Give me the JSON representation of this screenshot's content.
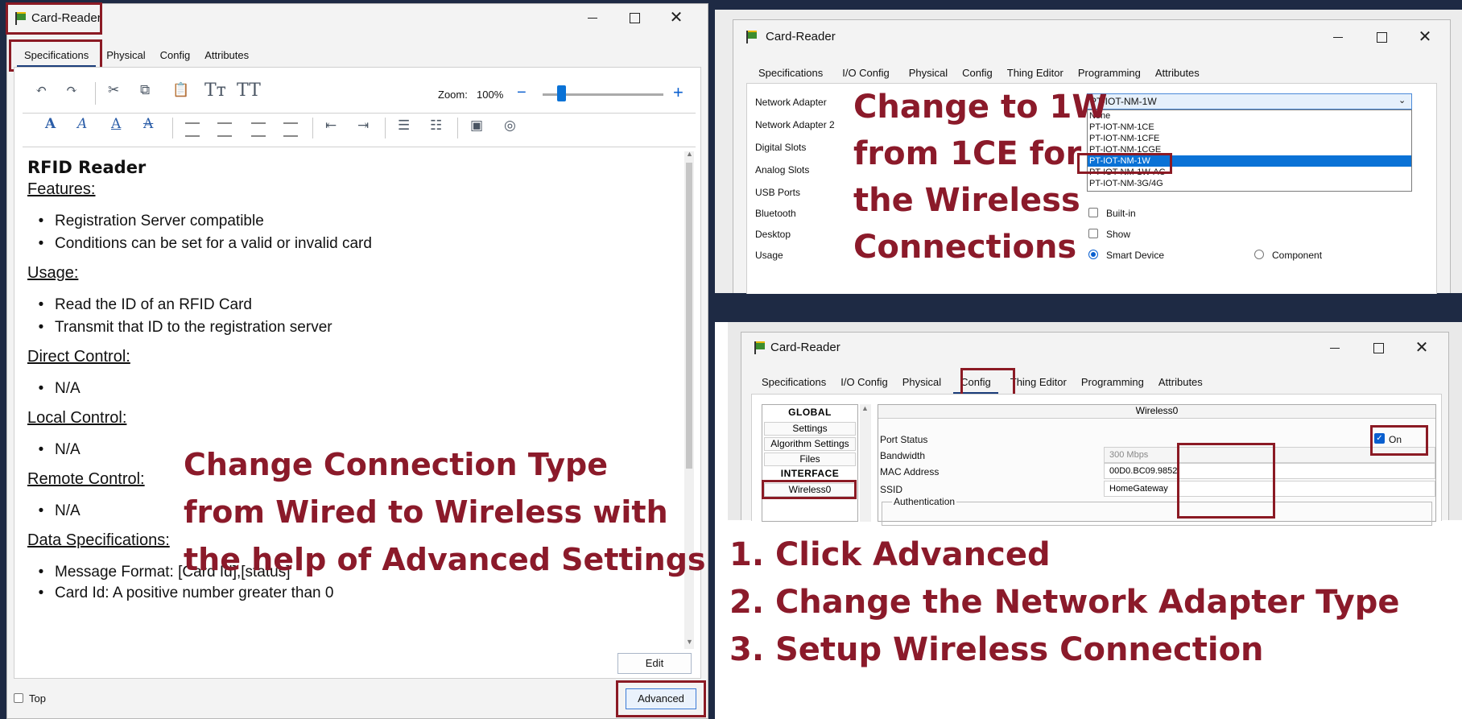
{
  "window_left": {
    "title": "Card-Reader",
    "tabs": [
      "Specifications",
      "Physical",
      "Config",
      "Attributes"
    ],
    "active_tab": "Specifications",
    "zoom_label": "Zoom:",
    "zoom_value": "100%",
    "zoom_minus": "−",
    "zoom_plus": "+",
    "zoom_slider_fraction": 0.17,
    "toolbar_icons": [
      "undo-icon",
      "redo-icon",
      "cut-icon",
      "copy-icon",
      "paste-icon",
      "font-size-icon",
      "font-size-up-icon"
    ],
    "doc": {
      "title": "RFID Reader",
      "sections": [
        {
          "heading": "Features:",
          "items": [
            "Registration Server compatible",
            "Conditions can be set for a valid or invalid card"
          ]
        },
        {
          "heading": "Usage:",
          "items": [
            "Read the ID of an RFID Card",
            "Transmit that ID to the registration server"
          ]
        },
        {
          "heading": "Direct Control:",
          "items": [
            "N/A"
          ]
        },
        {
          "heading": "Local Control:",
          "items": [
            "N/A"
          ]
        },
        {
          "heading": "Remote Control:",
          "items": [
            "N/A"
          ]
        },
        {
          "heading": "Data Specifications:",
          "items": [
            "Message Format: [Card Id],[status]",
            "Card Id: A positive number greater than 0"
          ]
        }
      ]
    },
    "edit_button": "Edit",
    "top_checkbox": "Top",
    "advanced_button": "Advanced"
  },
  "callout_left": [
    "Change Connection Type",
    "from Wired to Wireless with",
    "the help of Advanced Settings"
  ],
  "window_top_right": {
    "title": "Card-Reader",
    "tabs": [
      "Specifications",
      "I/O Config",
      "Physical",
      "Config",
      "Thing Editor",
      "Programming",
      "Attributes"
    ],
    "active_tab": "I/O Config",
    "labels": [
      "Network Adapter",
      "Network Adapter 2",
      "Digital Slots",
      "Analog Slots",
      "USB Ports",
      "Bluetooth",
      "Desktop",
      "Usage"
    ],
    "network_adapter_value": "PT-IOT-NM-1W",
    "dropdown_options": [
      "None",
      "PT-IOT-NM-1CE",
      "PT-IOT-NM-1CFE",
      "PT-IOT-NM-1CGE",
      "PT-IOT-NM-1W",
      "PT-IOT-NM-1W-AC",
      "PT-IOT-NM-3G/4G"
    ],
    "dropdown_selected": "PT-IOT-NM-1W",
    "bluetooth_checkbox": "Built-in",
    "desktop_checkbox": "Show",
    "usage_option_1": "Smart Device",
    "usage_option_2": "Component"
  },
  "callout_top_right": [
    "Change to 1W",
    "from 1CE for",
    "the Wireless",
    "Connections"
  ],
  "window_bottom_right": {
    "title": "Card-Reader",
    "tabs": [
      "Specifications",
      "I/O Config",
      "Physical",
      "Config",
      "Thing Editor",
      "Programming",
      "Attributes"
    ],
    "active_tab": "Config",
    "nav": [
      "GLOBAL",
      "Settings",
      "Algorithm Settings",
      "Files",
      "INTERFACE",
      "Wireless0"
    ],
    "panel_title": "Wireless0",
    "port_status_label": "Port Status",
    "port_status_value": "On",
    "bandwidth_label": "Bandwidth",
    "bandwidth_value": "300 Mbps",
    "mac_label": "MAC Address",
    "mac_value": "00D0.BC09.9852",
    "ssid_label": "SSID",
    "ssid_value": "HomeGateway",
    "authentication_label": "Authentication"
  },
  "steps": [
    "1. Click Advanced",
    "2. Change the Network Adapter Type",
    "3. Setup Wireless Connection"
  ],
  "colors": {
    "annotation": "#8b1a2a",
    "accent": "#0a72d6",
    "tab_underline": "#1b3d7a"
  }
}
